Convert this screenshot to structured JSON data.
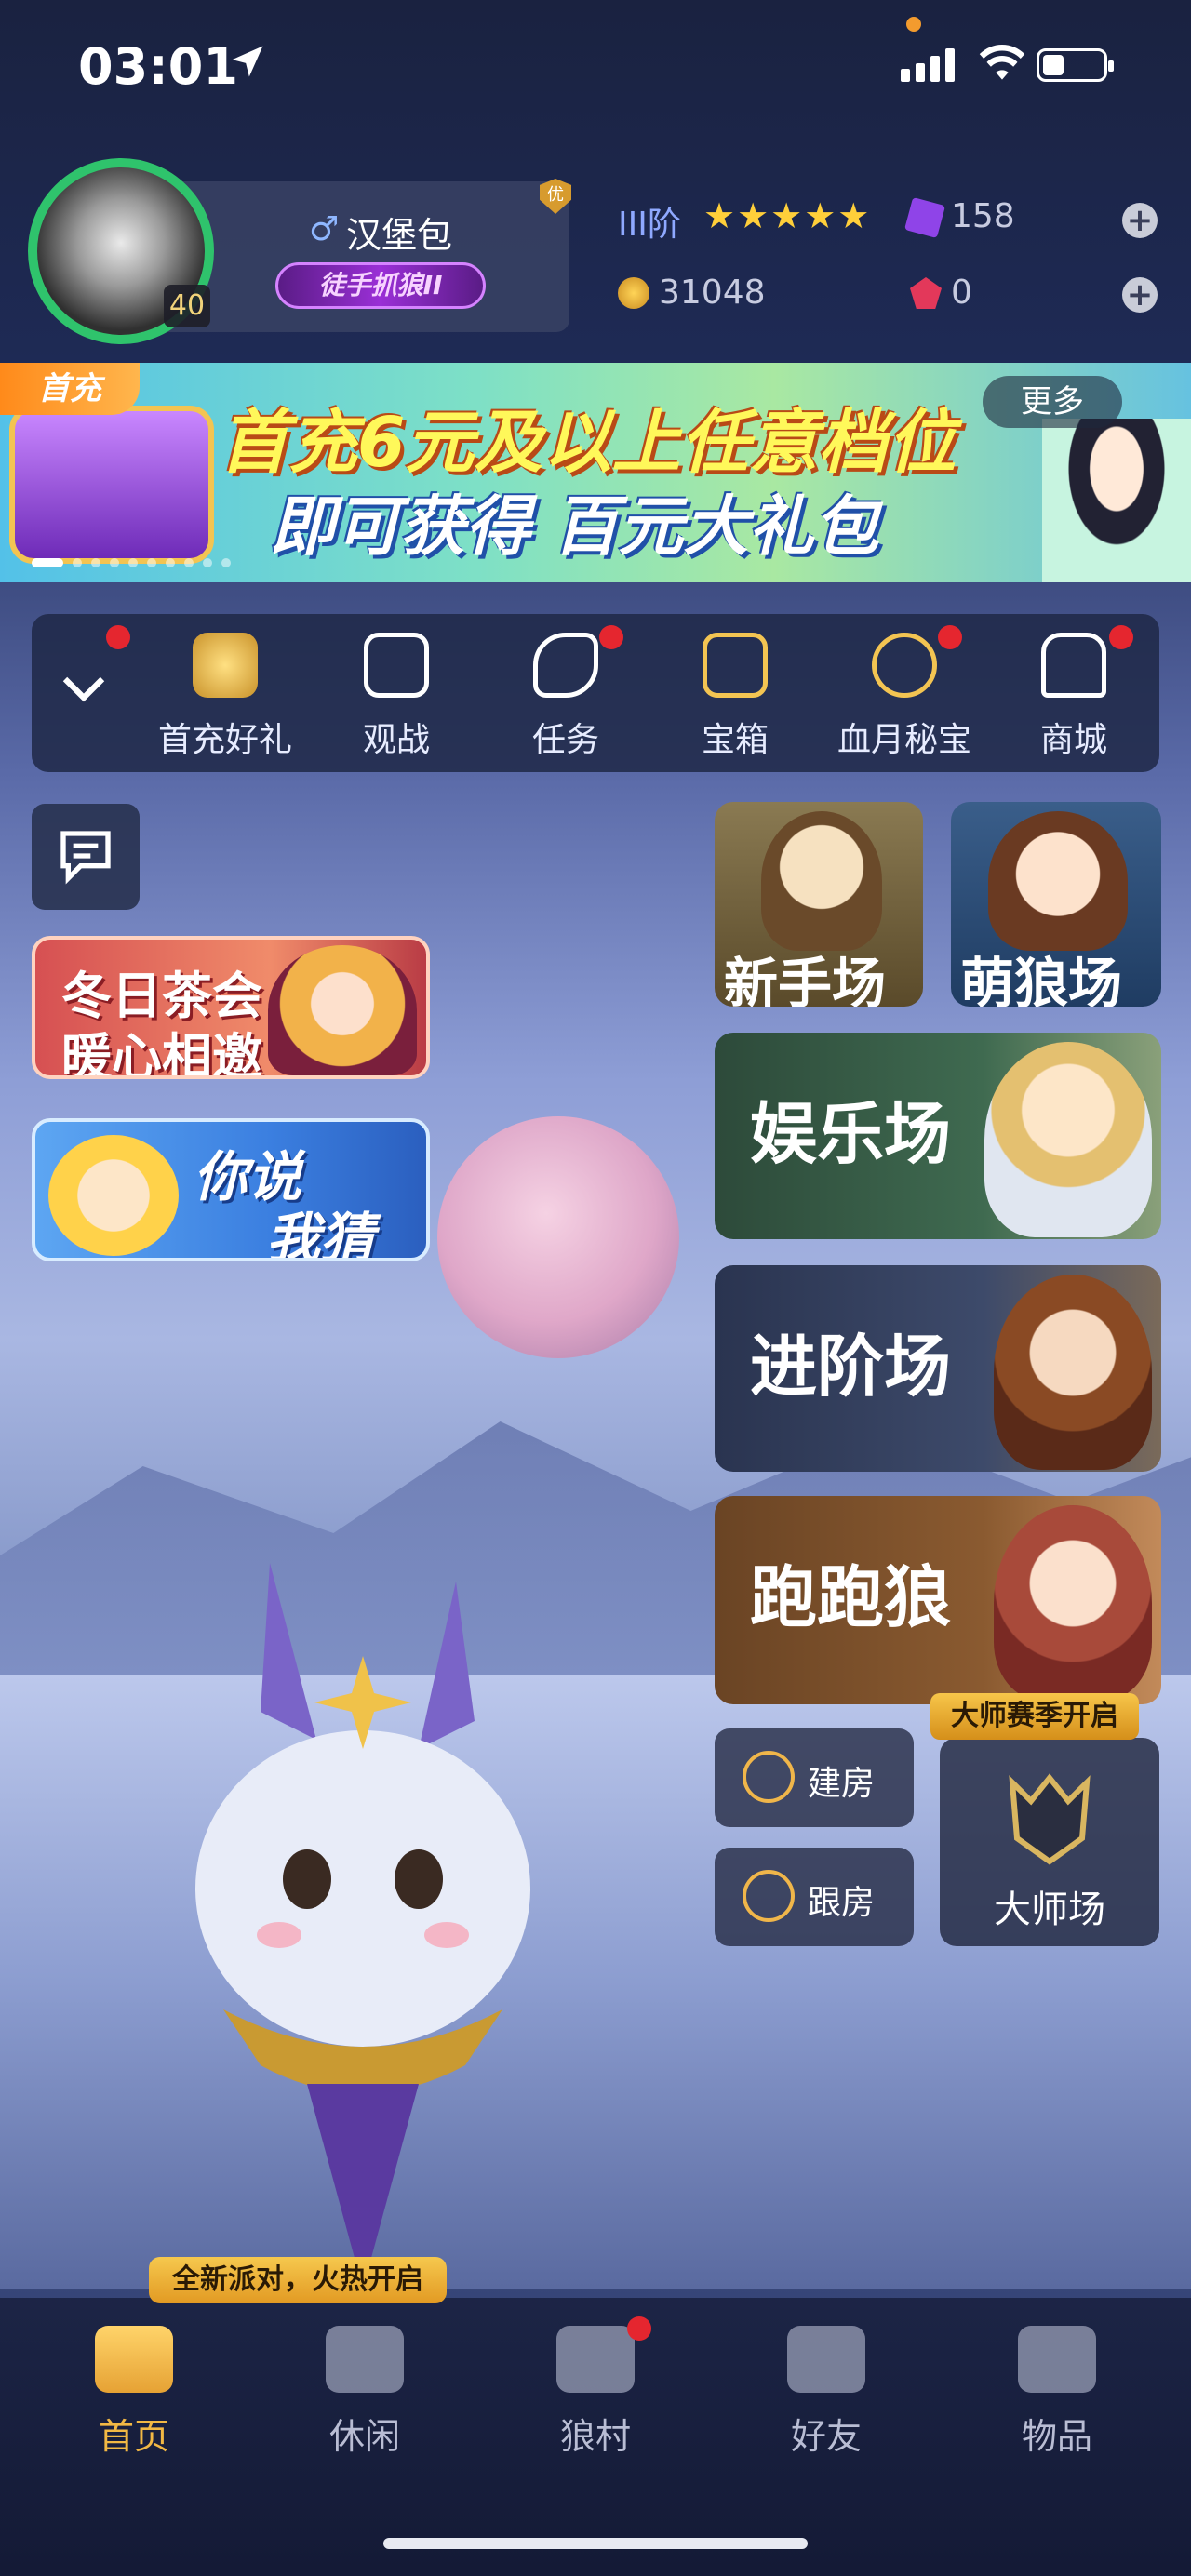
{
  "status_bar": {
    "time": "03:01"
  },
  "profile": {
    "name": "汉堡包",
    "gender_symbol": "♂",
    "level": "40",
    "title_badge": "徒手抓狼II",
    "vip_label": "优",
    "rank": "III阶",
    "stars": "★★★★★",
    "purple_gems": "158",
    "gold_coins": "31048",
    "red_gems": "0"
  },
  "banner": {
    "tag": "首充",
    "line1": "首充6元及以上任意档位",
    "line2": "即可获得 百元大礼包",
    "more_label": "更多"
  },
  "quick_menu": {
    "items": [
      {
        "label": "首充好礼",
        "icon": "coin-icon",
        "badge": true
      },
      {
        "label": "观战",
        "icon": "tv-icon",
        "badge": false
      },
      {
        "label": "任务",
        "icon": "scroll-icon",
        "badge": true
      },
      {
        "label": "宝箱",
        "icon": "chest-icon",
        "badge": false
      },
      {
        "label": "血月秘宝",
        "icon": "moon-treasure-icon",
        "badge": true
      },
      {
        "label": "商城",
        "icon": "shop-icon",
        "badge": true
      }
    ]
  },
  "events": {
    "tea_party": {
      "line1": "冬日茶会",
      "line2": "暖心相邀"
    },
    "guess": {
      "line1": "你说",
      "line2": "我猜"
    }
  },
  "modes": {
    "newbie": "新手场",
    "cute_wolf": "萌狼场",
    "entertainment": "娱乐场",
    "advanced": "进阶场",
    "running_wolf": "跑跑狼",
    "master_season_tag": "大师赛季开启",
    "master": "大师场",
    "create_room": "建房",
    "follow_room": "跟房"
  },
  "party_notice": "全新派对，火热开启",
  "tabbar": {
    "items": [
      {
        "label": "首页",
        "active": true
      },
      {
        "label": "休闲",
        "active": false
      },
      {
        "label": "狼村",
        "active": false,
        "badge": true
      },
      {
        "label": "好友",
        "active": false
      },
      {
        "label": "物品",
        "active": false
      }
    ]
  },
  "colors": {
    "accent_gold": "#f2b844",
    "badge_red": "#e5262f",
    "avatar_ring": "#2fc36c"
  }
}
